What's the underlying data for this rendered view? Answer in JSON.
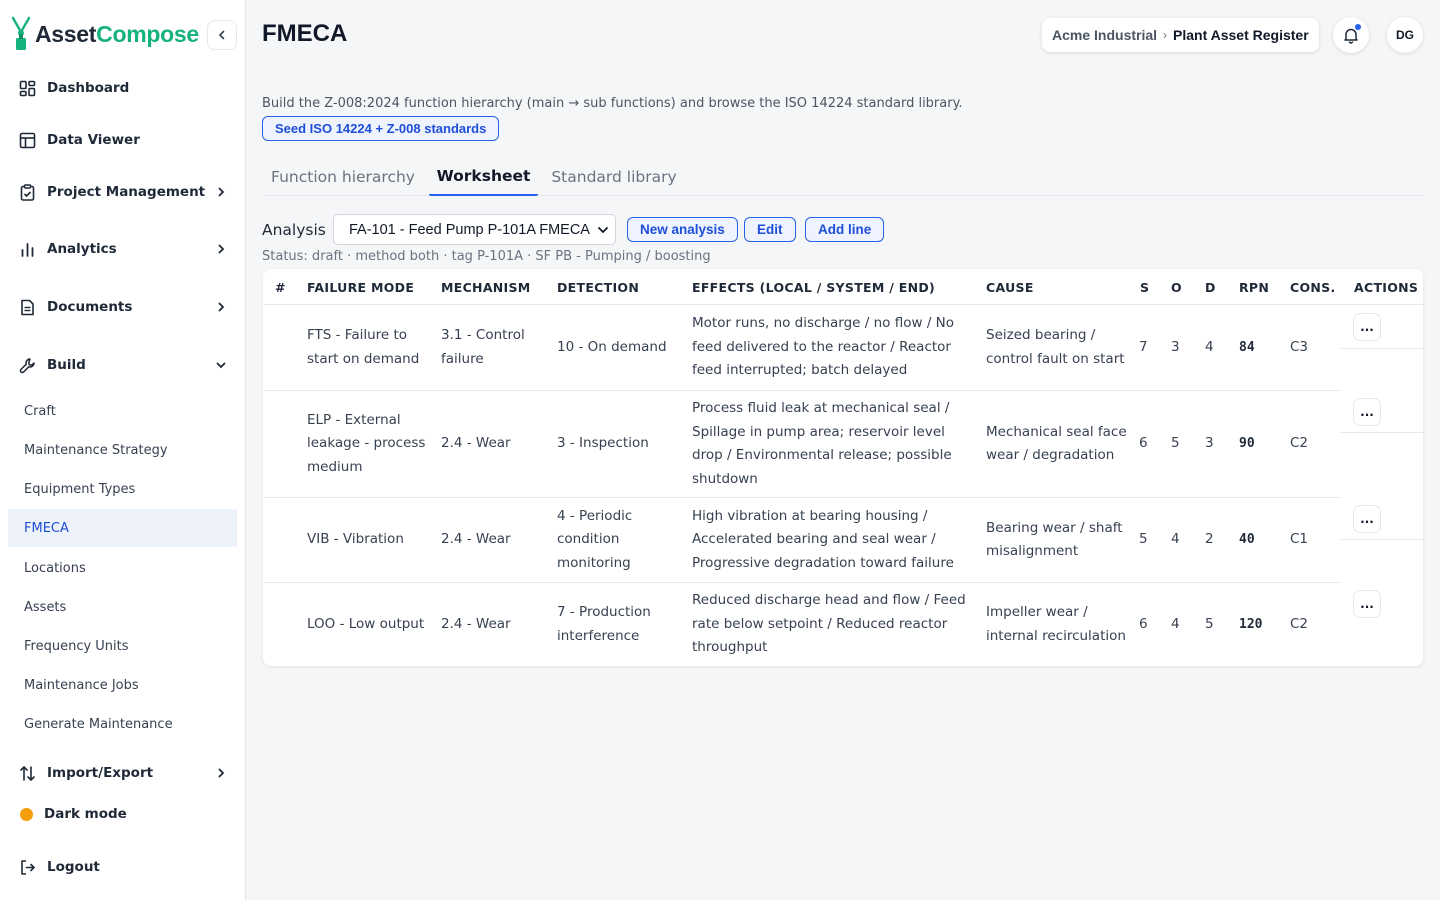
{
  "app": {
    "logo_part1": "Asset",
    "logo_part2": "Compose",
    "brand_color": "#16b37c",
    "accent_color": "#2563eb"
  },
  "sidebar": {
    "nav": [
      {
        "label": "Dashboard",
        "icon": "dashboard-icon"
      },
      {
        "label": "Data Viewer",
        "icon": "table-icon"
      },
      {
        "label": "Project Management",
        "icon": "clipboard-icon"
      },
      {
        "label": "Analytics",
        "icon": "bar-chart-icon"
      },
      {
        "label": "Documents",
        "icon": "document-icon"
      },
      {
        "label": "Build",
        "icon": "wrench-icon"
      }
    ],
    "build_items": [
      "Craft",
      "Maintenance Strategy",
      "Equipment Types",
      "FMECA",
      "Locations",
      "Assets",
      "Frequency Units",
      "Maintenance Jobs",
      "Generate Maintenance"
    ],
    "import_export": "Import/Export",
    "dark_mode": "Dark mode",
    "logout": "Logout"
  },
  "header": {
    "title": "FMECA",
    "breadcrumb_org": "Acme Industrial",
    "breadcrumb_sep": "›",
    "breadcrumb_register": "Plant Asset Register",
    "avatar_initials": "DG"
  },
  "main": {
    "description": "Build the Z-008:2024 function hierarchy (main → sub functions) and browse the ISO 14224 standard library.",
    "seed_button": "Seed ISO 14224 + Z-008 standards",
    "tabs": [
      "Function hierarchy",
      "Worksheet",
      "Standard library"
    ],
    "active_tab": "Worksheet",
    "analysis_label": "Analysis",
    "analysis_selected": "FA-101 - Feed Pump P-101A FMECA",
    "new_analysis": "New analysis",
    "edit": "Edit",
    "add_line": "Add line",
    "status": "Status: draft · method both · tag P-101A · SF PB - Pumping / boosting"
  },
  "table": {
    "columns": [
      "#",
      "FAILURE MODE",
      "MECHANISM",
      "DETECTION",
      "EFFECTS (LOCAL / SYSTEM / END)",
      "CAUSE",
      "S",
      "O",
      "D",
      "RPN",
      "CONS.",
      "ACTIONS"
    ],
    "action_label": "...",
    "rows": [
      {
        "num": "",
        "failure_mode": "FTS - Failure to start on demand",
        "mechanism": "3.1 - Control failure",
        "detection": "10 - On demand",
        "effects": "Motor runs, no discharge / no flow / No feed delivered to the reactor / Reactor feed interrupted; batch delayed",
        "cause": "Seized bearing / control fault on start",
        "s": "7",
        "o": "3",
        "d": "4",
        "rpn": "84",
        "cons": "C3"
      },
      {
        "num": "",
        "failure_mode": "ELP - External leakage - process medium",
        "mechanism": "2.4 - Wear",
        "detection": "3 - Inspection",
        "effects": "Process fluid leak at mechanical seal / Spillage in pump area; reservoir level drop / Environmental release; possible shutdown",
        "cause": "Mechanical seal face wear / degradation",
        "s": "6",
        "o": "5",
        "d": "3",
        "rpn": "90",
        "cons": "C2"
      },
      {
        "num": "",
        "failure_mode": "VIB - Vibration",
        "mechanism": "2.4 - Wear",
        "detection": "4 - Periodic condition monitoring",
        "effects": "High vibration at bearing housing / Accelerated bearing and seal wear / Progressive degradation toward failure",
        "cause": "Bearing wear / shaft misalignment",
        "s": "5",
        "o": "4",
        "d": "2",
        "rpn": "40",
        "cons": "C1"
      },
      {
        "num": "",
        "failure_mode": "LOO - Low output",
        "mechanism": "2.4 - Wear",
        "detection": "7 - Production interference",
        "effects": "Reduced discharge head and flow / Feed rate below setpoint / Reduced reactor throughput",
        "cause": "Impeller wear / internal recirculation",
        "s": "6",
        "o": "4",
        "d": "5",
        "rpn": "120",
        "cons": "C2"
      }
    ]
  }
}
